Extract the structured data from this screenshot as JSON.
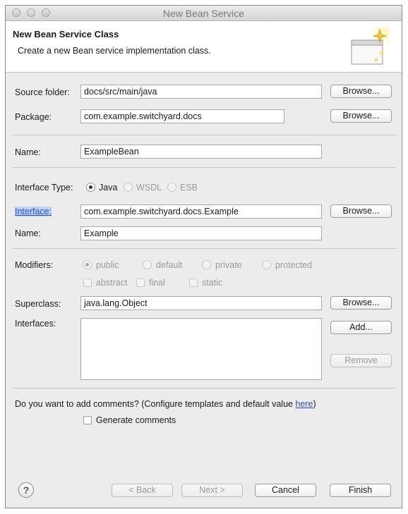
{
  "window": {
    "title": "New Bean Service"
  },
  "banner": {
    "title": "New Bean Service Class",
    "description": "Create a new Bean service implementation class."
  },
  "form": {
    "source_folder": {
      "label": "Source folder:",
      "value": "docs/src/main/java",
      "button": "Browse..."
    },
    "package": {
      "label": "Package:",
      "value": "com.example.switchyard.docs",
      "button": "Browse..."
    },
    "name": {
      "label": "Name:",
      "value": "ExampleBean"
    },
    "interface_type": {
      "label": "Interface Type:",
      "options": [
        "Java",
        "WSDL",
        "ESB"
      ],
      "selected": "Java"
    },
    "interface": {
      "label": "Interface:",
      "value": "com.example.switchyard.docs.Example",
      "button": "Browse..."
    },
    "interface_name": {
      "label": "Name:",
      "value": "Example"
    },
    "modifiers": {
      "label": "Modifiers:",
      "access": [
        "public",
        "default",
        "private",
        "protected"
      ],
      "selected": "public",
      "flags": [
        "abstract",
        "final",
        "static"
      ]
    },
    "superclass": {
      "label": "Superclass:",
      "value": "java.lang.Object",
      "button": "Browse..."
    },
    "interfaces": {
      "label": "Interfaces:",
      "add_button": "Add...",
      "remove_button": "Remove"
    },
    "comments": {
      "question": "Do you want to add comments? (Configure templates and default value ",
      "link": "here",
      "suffix": ")",
      "checkbox": "Generate comments"
    }
  },
  "footer": {
    "help": "?",
    "back": "< Back",
    "next": "Next >",
    "cancel": "Cancel",
    "finish": "Finish"
  }
}
